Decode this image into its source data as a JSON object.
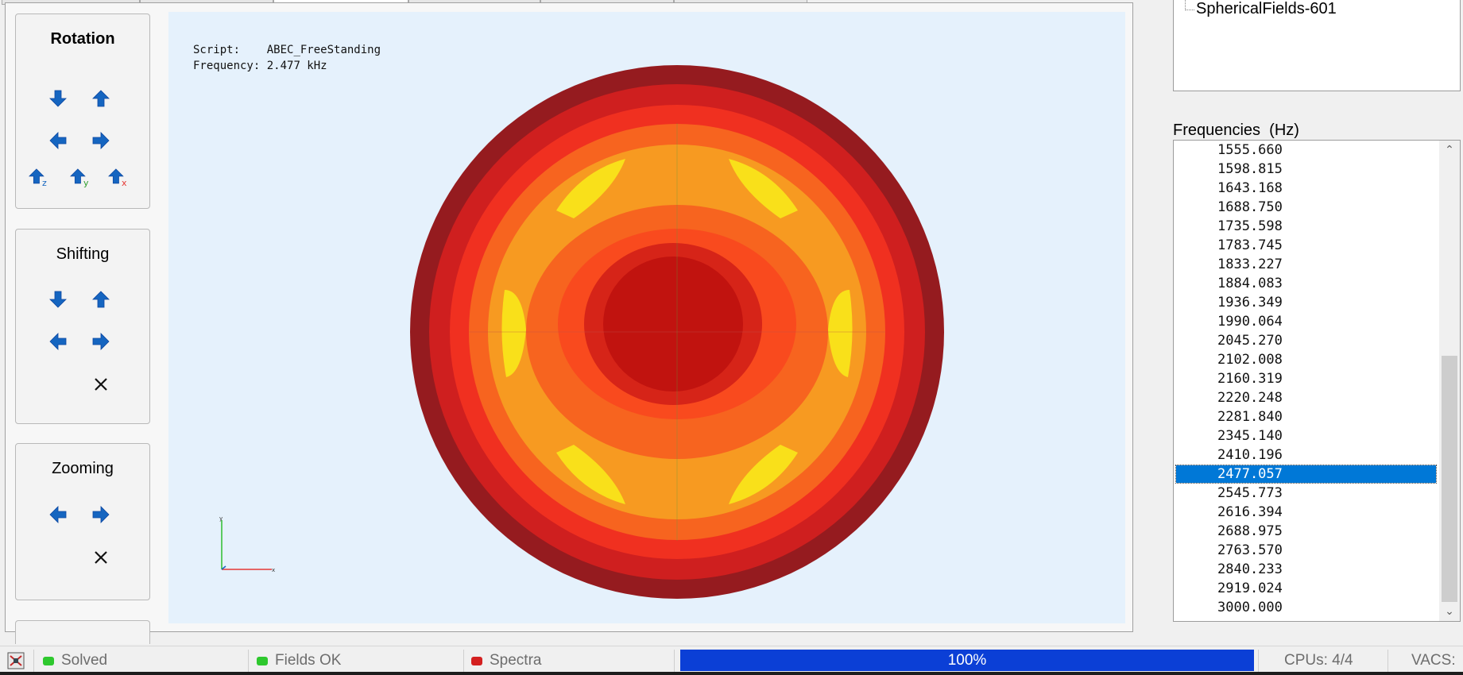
{
  "colors": {
    "accent": "#0078d7",
    "arrow": "#1565c0",
    "viewport_bg": "#e5f1fc",
    "progress": "#0b3fd6",
    "led_green": "#2ec82e",
    "led_red": "#d42020",
    "field_bands": [
      "#951b1f",
      "#cf1f1f",
      "#f03020",
      "#f7641f",
      "#f79a21",
      "#f8a41f",
      "#f9e01a",
      "#f94a1e",
      "#d62418",
      "#c1130f"
    ]
  },
  "controls": {
    "rotation": {
      "title": "Rotation",
      "buttons": [
        "arrow-down",
        "arrow-up",
        "arrow-left",
        "arrow-right",
        "rotate-z",
        "rotate-y",
        "rotate-x"
      ],
      "axis_labels": {
        "z": "z",
        "y": "y",
        "x": "x"
      }
    },
    "shifting": {
      "title": "Shifting",
      "buttons": [
        "arrow-down",
        "arrow-up",
        "arrow-left",
        "arrow-right",
        "reset"
      ]
    },
    "zooming": {
      "title": "Zooming",
      "buttons": [
        "arrow-left",
        "arrow-right",
        "reset"
      ]
    }
  },
  "viewport": {
    "script_label": "Script:",
    "script_value": "ABEC_FreeStanding",
    "frequency_label": "Frequency:",
    "frequency_value": "2.477 kHz",
    "axis_icon": "coordinate-axes-icon"
  },
  "tree": {
    "items": [
      "SphericalFields-601"
    ]
  },
  "frequencies": {
    "label": "Frequencies  (Hz)",
    "items": [
      "1555.660",
      "1598.815",
      "1643.168",
      "1688.750",
      "1735.598",
      "1783.745",
      "1833.227",
      "1884.083",
      "1936.349",
      "1990.064",
      "2045.270",
      "2102.008",
      "2160.319",
      "2220.248",
      "2281.840",
      "2345.140",
      "2410.196",
      "2477.057",
      "2545.773",
      "2616.394",
      "2688.975",
      "2763.570",
      "2840.233",
      "2919.024",
      "3000.000"
    ],
    "selected": "2477.057"
  },
  "status": {
    "app_icon": "app-icon",
    "solved": "Solved",
    "fields_ok": "Fields OK",
    "spectra": "Spectra",
    "progress_text": "100%",
    "progress_value": 1.0,
    "cpus": "CPUs: 4/4",
    "vacs": "VACS: "
  }
}
